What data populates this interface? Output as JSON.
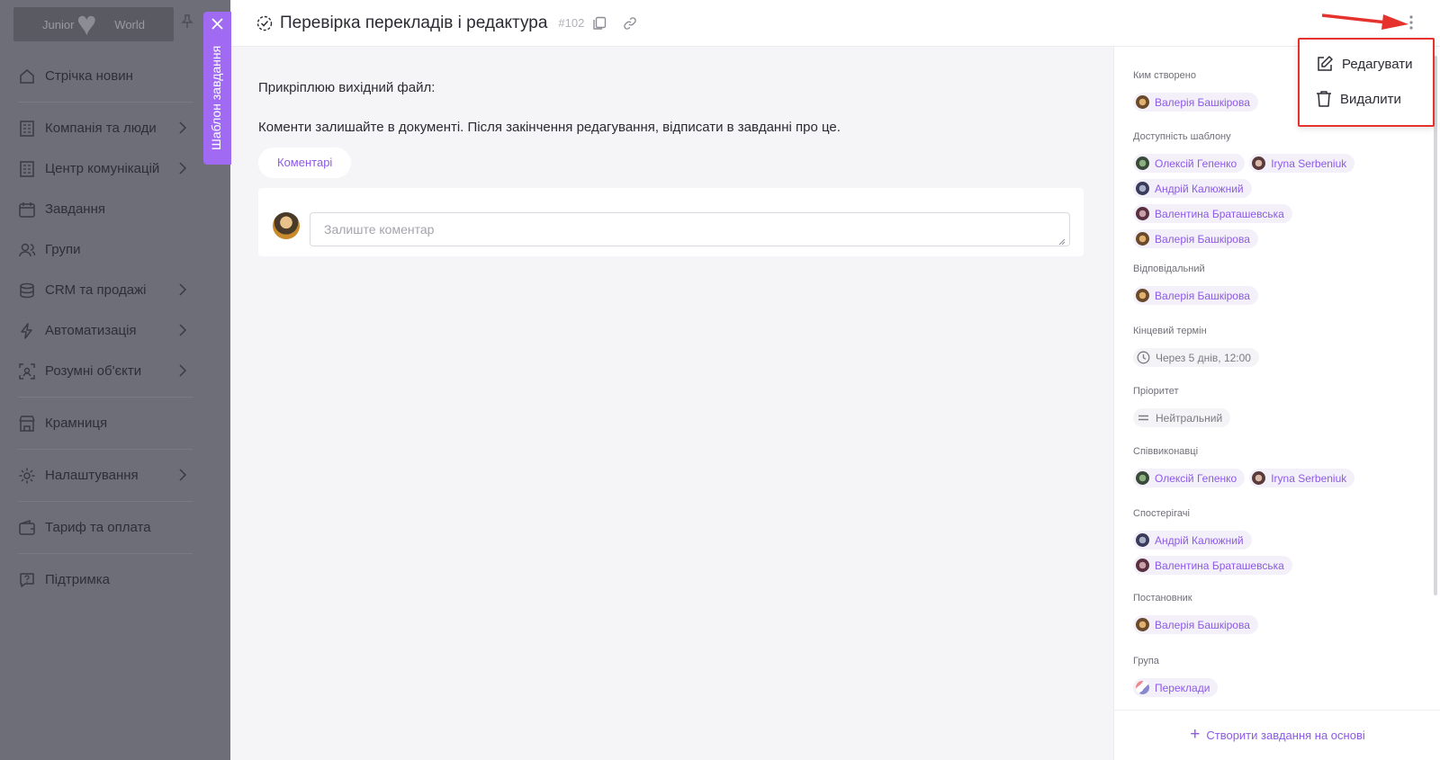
{
  "sidebar": {
    "logo_left": "Junior",
    "logo_right": "World",
    "items": [
      {
        "label": "Стрічка новин",
        "icon": "home-icon",
        "chevron": false
      },
      {
        "label": "Компанія та люди",
        "icon": "building-icon",
        "chevron": true
      },
      {
        "label": "Центр комунікацій",
        "icon": "building-icon",
        "chevron": true
      },
      {
        "label": "Завдання",
        "icon": "calendar-icon",
        "chevron": false
      },
      {
        "label": "Групи",
        "icon": "users-icon",
        "chevron": false
      },
      {
        "label": "CRM та продажі",
        "icon": "database-icon",
        "chevron": true
      },
      {
        "label": "Автоматизація",
        "icon": "lightning-icon",
        "chevron": true
      },
      {
        "label": "Розумні об'єкти",
        "icon": "scan-icon",
        "chevron": true
      },
      {
        "label": "Крамниця",
        "icon": "store-icon",
        "chevron": false
      },
      {
        "label": "Налаштування",
        "icon": "gear-icon",
        "chevron": true
      },
      {
        "label": "Тариф та оплата",
        "icon": "wallet-icon",
        "chevron": false
      },
      {
        "label": "Підтримка",
        "icon": "help-icon",
        "chevron": false
      }
    ]
  },
  "side_tab": {
    "label": "Шаблон завдання"
  },
  "header": {
    "title": "Перевірка перекладів і редактура",
    "number": "#102"
  },
  "content": {
    "line1": "Прикріплюю вихідний файл:",
    "line2": "Коменти залишайте в документі. Після закінчення редагування, відписати в завданні про це.",
    "comments_tab": "Коментарі",
    "comment_placeholder": "Залиште коментар"
  },
  "details": {
    "created_by": {
      "label": "Ким створено",
      "people": [
        "Валерія Башкірова"
      ]
    },
    "template_access": {
      "label": "Доступність шаблону",
      "people": [
        "Олексій Гепенко",
        "Iryna Serbeniuk",
        "Андрій Калюжний",
        "Валентина Браташевська",
        "Валерія Башкірова"
      ]
    },
    "responsible": {
      "label": "Відповідальний",
      "people": [
        "Валерія Башкірова"
      ]
    },
    "deadline": {
      "label": "Кінцевий термін",
      "value": "Через 5 днів, 12:00"
    },
    "priority": {
      "label": "Пріоритет",
      "value": "Нейтральний"
    },
    "co_executors": {
      "label": "Співвиконавці",
      "people": [
        "Олексій Гепенко",
        "Iryna Serbeniuk"
      ]
    },
    "observers": {
      "label": "Спостерігачі",
      "people": [
        "Андрій Калюжний",
        "Валентина Браташевська"
      ]
    },
    "director": {
      "label": "Постановник",
      "people": [
        "Валерія Башкірова"
      ]
    },
    "group": {
      "label": "Група",
      "value": "Переклади"
    },
    "create_based": "Створити завдання на основі"
  },
  "menu": {
    "edit": "Редагувати",
    "delete": "Видалити"
  },
  "colors": {
    "accent": "#8d5ae6",
    "side_tab": "#a06bf2",
    "highlight": "#e5322d"
  }
}
